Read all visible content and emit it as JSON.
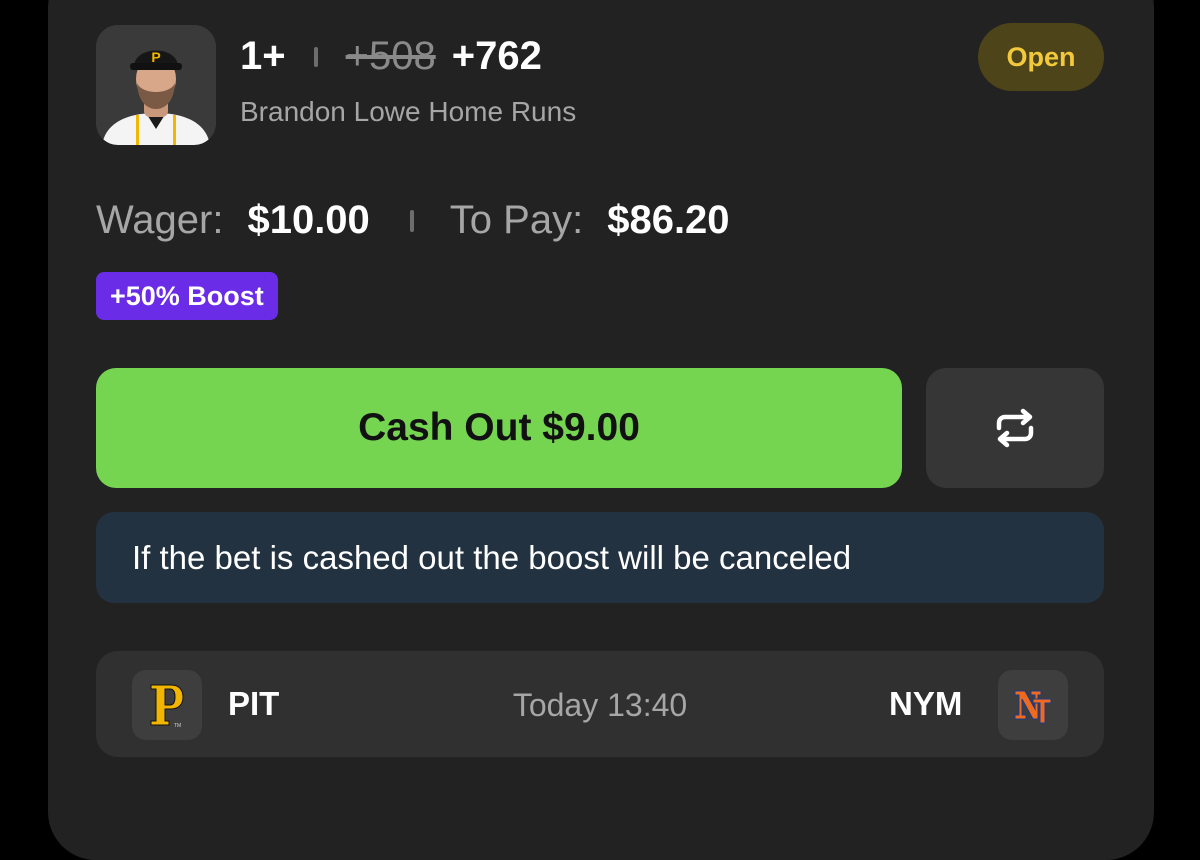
{
  "bet": {
    "selection": "1+",
    "old_odds": "+508",
    "new_odds": "+762",
    "market": "Brandon Lowe Home Runs",
    "status": "Open"
  },
  "wager": {
    "wager_label": "Wager:",
    "wager_value": "$10.00",
    "to_pay_label": "To Pay:",
    "to_pay_value": "$86.20"
  },
  "boost": {
    "label": "+50% Boost"
  },
  "actions": {
    "cashout_label": "Cash Out $9.00",
    "refresh_icon": "swap-arrows-icon"
  },
  "notice": {
    "text": "If the bet is cashed out the boost will be canceled"
  },
  "game": {
    "home_team": "PIT",
    "time": "Today 13:40",
    "away_team": "NYM",
    "home_logo_icon": "pirates-logo-icon",
    "away_logo_icon": "mets-logo-icon"
  },
  "colors": {
    "card_bg": "#222222",
    "status_bg": "#4d4419",
    "status_text": "#f3c93c",
    "boost_bg": "#6a2ce6",
    "cashout_bg": "#75d550",
    "notice_bg": "#223241"
  }
}
